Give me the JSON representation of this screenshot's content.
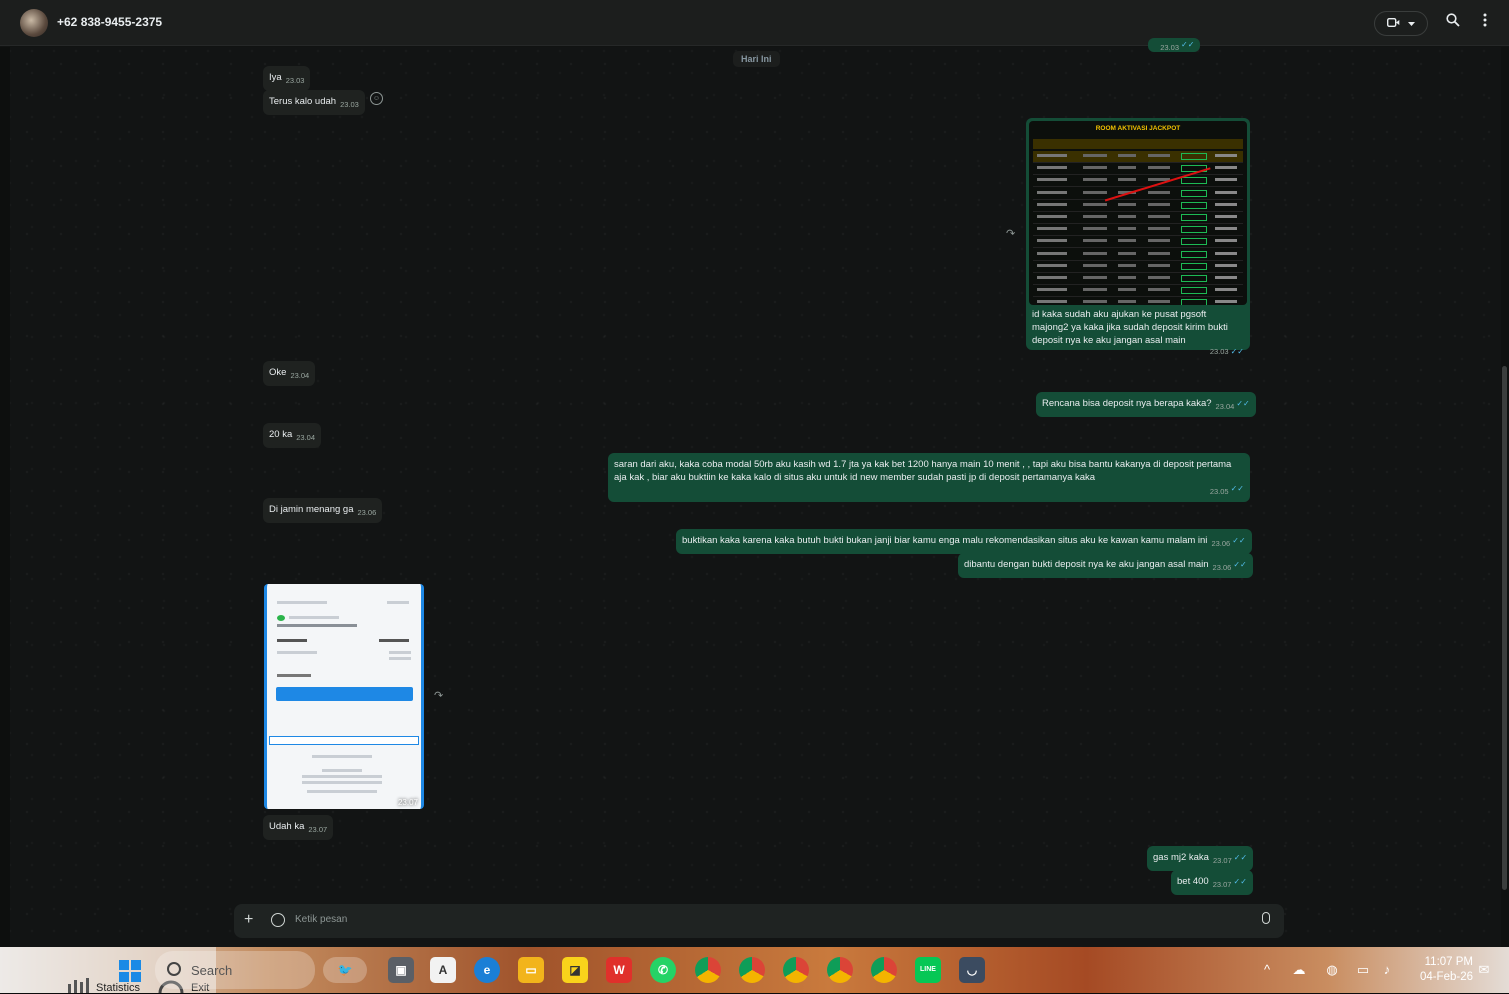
{
  "header": {
    "contact_name": "+62 838-9455-2375",
    "video_icon": "video-call-icon",
    "dropdown_icon": "chevron-down-icon",
    "search_icon": "search-icon",
    "menu_icon": "more-vertical-icon"
  },
  "day_label": "Hari Ini",
  "top_partial": {
    "time": "23.03"
  },
  "messages": [
    {
      "dir": "in",
      "text": "Iya",
      "time": "23.03"
    },
    {
      "dir": "in",
      "text": "Terus kalo udah",
      "time": "23.03"
    },
    {
      "dir": "out",
      "type": "image",
      "image_title": "ROOM AKTIVASI JACKPOT",
      "caption": "id kaka sudah aku ajukan ke pusat pgsoft majong2 ya kaka jika sudah deposit kirim bukti deposit nya ke aku jangan asal main",
      "time": "23.03"
    },
    {
      "dir": "in",
      "text": "Oke",
      "time": "23.04"
    },
    {
      "dir": "out",
      "text": "Rencana bisa deposit nya berapa kaka?",
      "time": "23.04"
    },
    {
      "dir": "in",
      "text": "20 ka",
      "time": "23.04"
    },
    {
      "dir": "out",
      "text_line1": "saran dari aku, kaka coba modal 50rb aku kasih wd 1.7 jta ya kak bet 1200 hanya main 10 menit , , tapi aku bisa bantu kakanya di deposit pertama",
      "text_line2": "aja kak , biar aku buktiin ke kaka kalo di situs aku untuk id new member sudah pasti jp di deposit pertamanya kaka",
      "time": "23.05"
    },
    {
      "dir": "in",
      "text": "Di jamin menang ga",
      "time": "23.06"
    },
    {
      "dir": "out",
      "text": "buktikan kaka karena kaka butuh bukti bukan janji biar kamu enga malu rekomendasikan situs aku ke kawan kamu malam ini",
      "time": "23.06"
    },
    {
      "dir": "out",
      "text": "dibantu dengan bukti deposit nya ke aku jangan asal main",
      "time": "23.06"
    },
    {
      "dir": "in",
      "type": "image",
      "time": "23.07"
    },
    {
      "dir": "in",
      "text": "Udah ka",
      "time": "23.07"
    },
    {
      "dir": "out",
      "text": "gas mj2 kaka",
      "time": "23.07"
    },
    {
      "dir": "out",
      "text": "bet 400",
      "time": "23.07"
    }
  ],
  "composer": {
    "placeholder": "Ketik pesan",
    "attach_icon": "plus-icon",
    "sticker_icon": "sticker-icon",
    "mic_icon": "microphone-icon"
  },
  "taskbar": {
    "widget_label": "Statistics",
    "exit_label": "Exit",
    "search_label": "Search",
    "time": "11:07 PM",
    "date": "04-Feb-26"
  },
  "colors": {
    "outgoing_bubble": "#144d37",
    "incoming_bubble": "#1f2220",
    "read_ticks": "#53bdeb"
  }
}
